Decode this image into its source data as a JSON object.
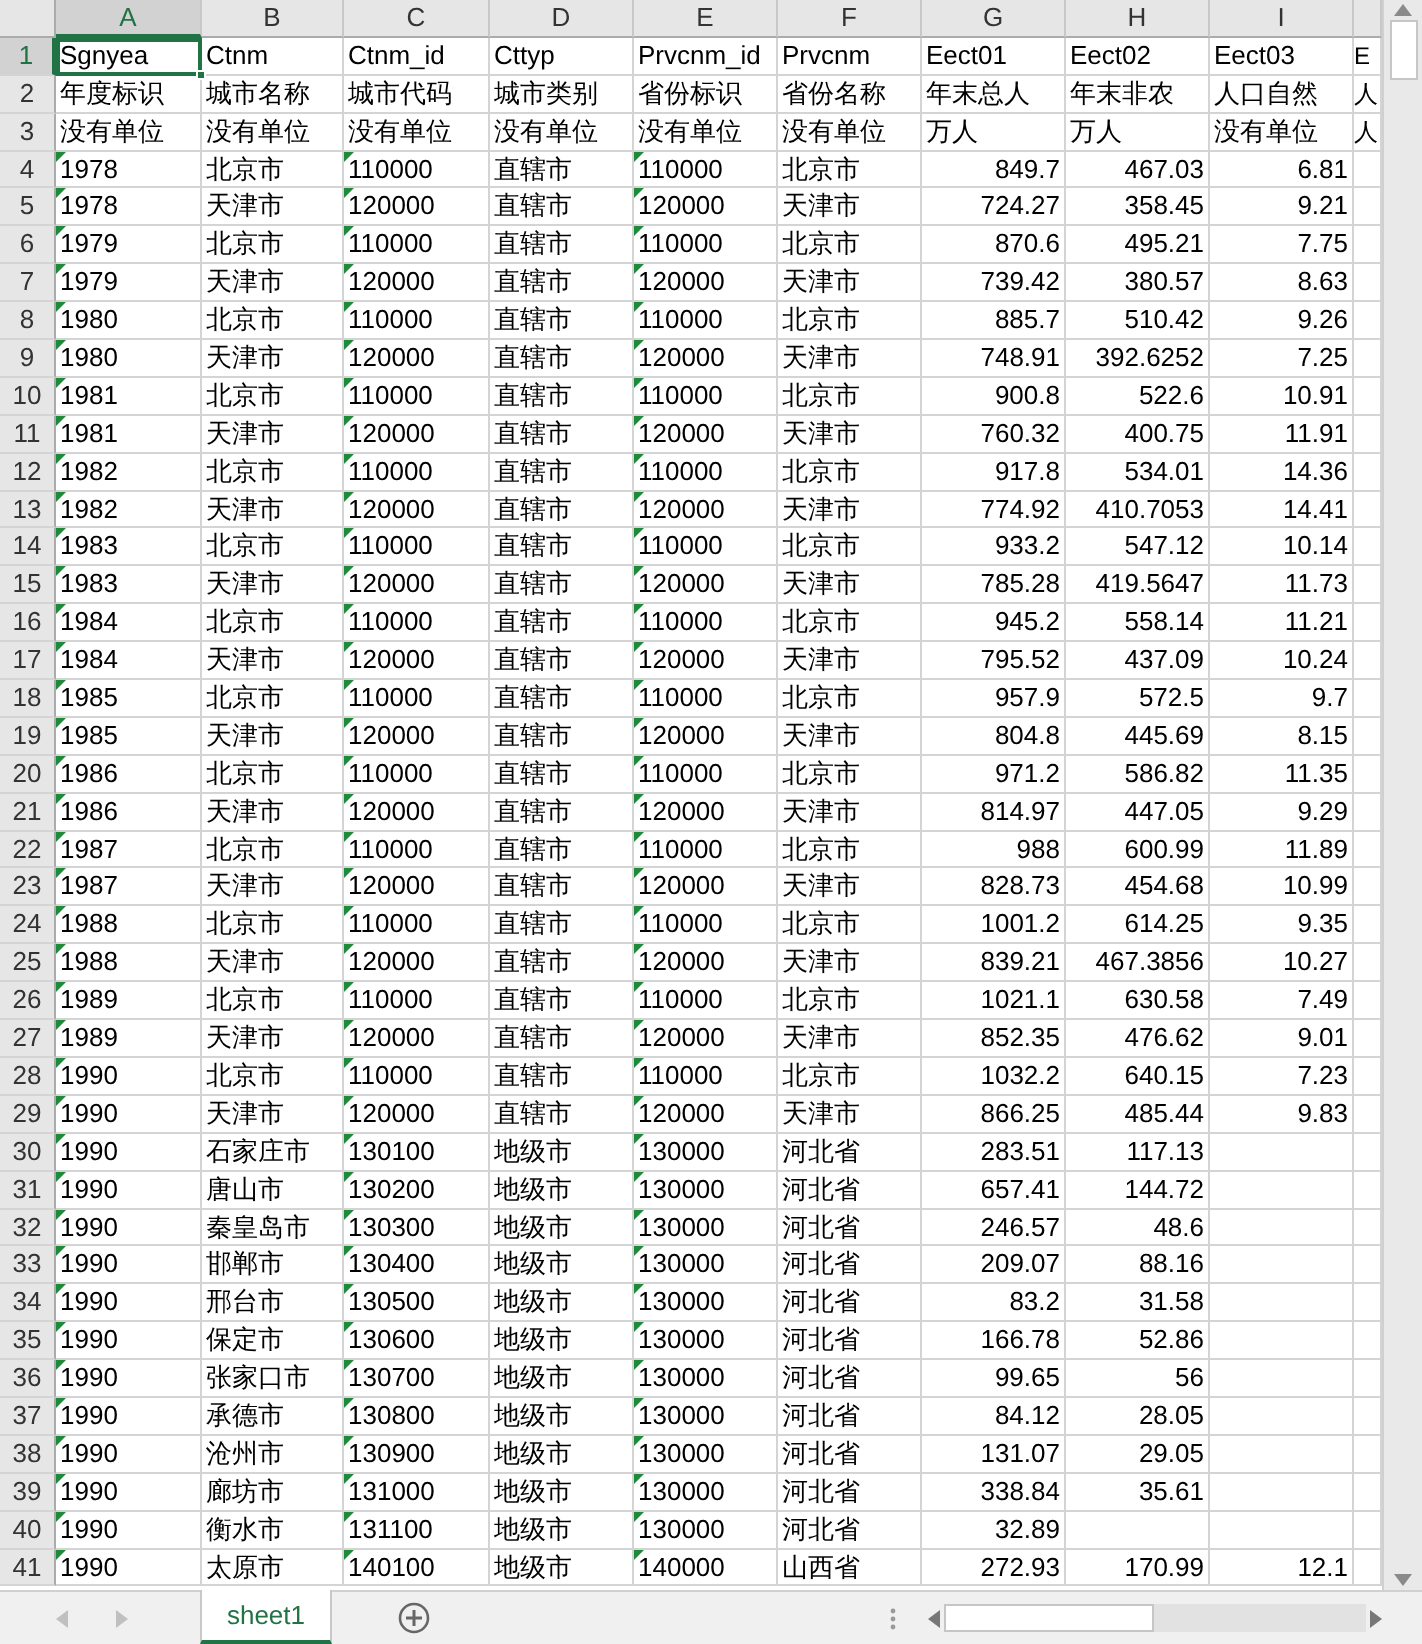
{
  "columns": [
    {
      "letter": "A",
      "selected": true,
      "error_flag": true,
      "numeric": false
    },
    {
      "letter": "B",
      "selected": false,
      "error_flag": false,
      "numeric": false
    },
    {
      "letter": "C",
      "selected": false,
      "error_flag": true,
      "numeric": false
    },
    {
      "letter": "D",
      "selected": false,
      "error_flag": false,
      "numeric": false
    },
    {
      "letter": "E",
      "selected": false,
      "error_flag": true,
      "numeric": false
    },
    {
      "letter": "F",
      "selected": false,
      "error_flag": false,
      "numeric": false
    },
    {
      "letter": "G",
      "selected": false,
      "error_flag": false,
      "numeric": true
    },
    {
      "letter": "H",
      "selected": false,
      "error_flag": false,
      "numeric": true
    },
    {
      "letter": "I",
      "selected": false,
      "error_flag": false,
      "numeric": true
    },
    {
      "selected": false,
      "error_flag": false,
      "numeric": false
    }
  ],
  "rows": [
    {
      "number": "1",
      "selected": true,
      "kind": "header",
      "cells": [
        "Sgnyea",
        "Ctnm",
        "Ctnm_id",
        "Cttyp",
        "Prvcnm_id",
        "Prvcnm",
        "Eect01",
        "Eect02",
        "Eect03",
        "E"
      ]
    },
    {
      "number": "2",
      "selected": false,
      "kind": "header",
      "cells": [
        "年度标识",
        "城市名称",
        "城市代码",
        "城市类别",
        "省份标识",
        "省份名称",
        "年末总人",
        "年末非农",
        "人口自然",
        "人"
      ]
    },
    {
      "number": "3",
      "selected": false,
      "kind": "header",
      "cells": [
        "没有单位",
        "没有单位",
        "没有单位",
        "没有单位",
        "没有单位",
        "没有单位",
        "万人",
        "万人",
        "没有单位",
        "人"
      ]
    },
    {
      "number": "4",
      "selected": false,
      "kind": "data",
      "cells": [
        "1978",
        "北京市",
        "110000",
        "直辖市",
        "110000",
        "北京市",
        "849.7",
        "467.03",
        "6.81"
      ]
    },
    {
      "number": "5",
      "selected": false,
      "kind": "data",
      "cells": [
        "1978",
        "天津市",
        "120000",
        "直辖市",
        "120000",
        "天津市",
        "724.27",
        "358.45",
        "9.21"
      ]
    },
    {
      "number": "6",
      "selected": false,
      "kind": "data",
      "cells": [
        "1979",
        "北京市",
        "110000",
        "直辖市",
        "110000",
        "北京市",
        "870.6",
        "495.21",
        "7.75"
      ]
    },
    {
      "number": "7",
      "selected": false,
      "kind": "data",
      "cells": [
        "1979",
        "天津市",
        "120000",
        "直辖市",
        "120000",
        "天津市",
        "739.42",
        "380.57",
        "8.63"
      ]
    },
    {
      "number": "8",
      "selected": false,
      "kind": "data",
      "cells": [
        "1980",
        "北京市",
        "110000",
        "直辖市",
        "110000",
        "北京市",
        "885.7",
        "510.42",
        "9.26"
      ]
    },
    {
      "number": "9",
      "selected": false,
      "kind": "data",
      "cells": [
        "1980",
        "天津市",
        "120000",
        "直辖市",
        "120000",
        "天津市",
        "748.91",
        "392.6252",
        "7.25"
      ]
    },
    {
      "number": "10",
      "selected": false,
      "kind": "data",
      "cells": [
        "1981",
        "北京市",
        "110000",
        "直辖市",
        "110000",
        "北京市",
        "900.8",
        "522.6",
        "10.91"
      ]
    },
    {
      "number": "11",
      "selected": false,
      "kind": "data",
      "cells": [
        "1981",
        "天津市",
        "120000",
        "直辖市",
        "120000",
        "天津市",
        "760.32",
        "400.75",
        "11.91"
      ]
    },
    {
      "number": "12",
      "selected": false,
      "kind": "data",
      "cells": [
        "1982",
        "北京市",
        "110000",
        "直辖市",
        "110000",
        "北京市",
        "917.8",
        "534.01",
        "14.36"
      ]
    },
    {
      "number": "13",
      "selected": false,
      "kind": "data",
      "cells": [
        "1982",
        "天津市",
        "120000",
        "直辖市",
        "120000",
        "天津市",
        "774.92",
        "410.7053",
        "14.41"
      ]
    },
    {
      "number": "14",
      "selected": false,
      "kind": "data",
      "cells": [
        "1983",
        "北京市",
        "110000",
        "直辖市",
        "110000",
        "北京市",
        "933.2",
        "547.12",
        "10.14"
      ]
    },
    {
      "number": "15",
      "selected": false,
      "kind": "data",
      "cells": [
        "1983",
        "天津市",
        "120000",
        "直辖市",
        "120000",
        "天津市",
        "785.28",
        "419.5647",
        "11.73"
      ]
    },
    {
      "number": "16",
      "selected": false,
      "kind": "data",
      "cells": [
        "1984",
        "北京市",
        "110000",
        "直辖市",
        "110000",
        "北京市",
        "945.2",
        "558.14",
        "11.21"
      ]
    },
    {
      "number": "17",
      "selected": false,
      "kind": "data",
      "cells": [
        "1984",
        "天津市",
        "120000",
        "直辖市",
        "120000",
        "天津市",
        "795.52",
        "437.09",
        "10.24"
      ]
    },
    {
      "number": "18",
      "selected": false,
      "kind": "data",
      "cells": [
        "1985",
        "北京市",
        "110000",
        "直辖市",
        "110000",
        "北京市",
        "957.9",
        "572.5",
        "9.7"
      ]
    },
    {
      "number": "19",
      "selected": false,
      "kind": "data",
      "cells": [
        "1985",
        "天津市",
        "120000",
        "直辖市",
        "120000",
        "天津市",
        "804.8",
        "445.69",
        "8.15"
      ]
    },
    {
      "number": "20",
      "selected": false,
      "kind": "data",
      "cells": [
        "1986",
        "北京市",
        "110000",
        "直辖市",
        "110000",
        "北京市",
        "971.2",
        "586.82",
        "11.35"
      ]
    },
    {
      "number": "21",
      "selected": false,
      "kind": "data",
      "cells": [
        "1986",
        "天津市",
        "120000",
        "直辖市",
        "120000",
        "天津市",
        "814.97",
        "447.05",
        "9.29"
      ]
    },
    {
      "number": "22",
      "selected": false,
      "kind": "data",
      "cells": [
        "1987",
        "北京市",
        "110000",
        "直辖市",
        "110000",
        "北京市",
        "988",
        "600.99",
        "11.89"
      ]
    },
    {
      "number": "23",
      "selected": false,
      "kind": "data",
      "cells": [
        "1987",
        "天津市",
        "120000",
        "直辖市",
        "120000",
        "天津市",
        "828.73",
        "454.68",
        "10.99"
      ]
    },
    {
      "number": "24",
      "selected": false,
      "kind": "data",
      "cells": [
        "1988",
        "北京市",
        "110000",
        "直辖市",
        "110000",
        "北京市",
        "1001.2",
        "614.25",
        "9.35"
      ]
    },
    {
      "number": "25",
      "selected": false,
      "kind": "data",
      "cells": [
        "1988",
        "天津市",
        "120000",
        "直辖市",
        "120000",
        "天津市",
        "839.21",
        "467.3856",
        "10.27"
      ]
    },
    {
      "number": "26",
      "selected": false,
      "kind": "data",
      "cells": [
        "1989",
        "北京市",
        "110000",
        "直辖市",
        "110000",
        "北京市",
        "1021.1",
        "630.58",
        "7.49"
      ]
    },
    {
      "number": "27",
      "selected": false,
      "kind": "data",
      "cells": [
        "1989",
        "天津市",
        "120000",
        "直辖市",
        "120000",
        "天津市",
        "852.35",
        "476.62",
        "9.01"
      ]
    },
    {
      "number": "28",
      "selected": false,
      "kind": "data",
      "cells": [
        "1990",
        "北京市",
        "110000",
        "直辖市",
        "110000",
        "北京市",
        "1032.2",
        "640.15",
        "7.23"
      ]
    },
    {
      "number": "29",
      "selected": false,
      "kind": "data",
      "cells": [
        "1990",
        "天津市",
        "120000",
        "直辖市",
        "120000",
        "天津市",
        "866.25",
        "485.44",
        "9.83"
      ]
    },
    {
      "number": "30",
      "selected": false,
      "kind": "data",
      "cells": [
        "1990",
        "石家庄市",
        "130100",
        "地级市",
        "130000",
        "河北省",
        "283.51",
        "117.13"
      ]
    },
    {
      "number": "31",
      "selected": false,
      "kind": "data",
      "cells": [
        "1990",
        "唐山市",
        "130200",
        "地级市",
        "130000",
        "河北省",
        "657.41",
        "144.72"
      ]
    },
    {
      "number": "32",
      "selected": false,
      "kind": "data",
      "cells": [
        "1990",
        "秦皇岛市",
        "130300",
        "地级市",
        "130000",
        "河北省",
        "246.57",
        "48.6"
      ]
    },
    {
      "number": "33",
      "selected": false,
      "kind": "data",
      "cells": [
        "1990",
        "邯郸市",
        "130400",
        "地级市",
        "130000",
        "河北省",
        "209.07",
        "88.16"
      ]
    },
    {
      "number": "34",
      "selected": false,
      "kind": "data",
      "cells": [
        "1990",
        "邢台市",
        "130500",
        "地级市",
        "130000",
        "河北省",
        "83.2",
        "31.58"
      ]
    },
    {
      "number": "35",
      "selected": false,
      "kind": "data",
      "cells": [
        "1990",
        "保定市",
        "130600",
        "地级市",
        "130000",
        "河北省",
        "166.78",
        "52.86"
      ]
    },
    {
      "number": "36",
      "selected": false,
      "kind": "data",
      "cells": [
        "1990",
        "张家口市",
        "130700",
        "地级市",
        "130000",
        "河北省",
        "99.65",
        "56"
      ]
    },
    {
      "number": "37",
      "selected": false,
      "kind": "data",
      "cells": [
        "1990",
        "承德市",
        "130800",
        "地级市",
        "130000",
        "河北省",
        "84.12",
        "28.05"
      ]
    },
    {
      "number": "38",
      "selected": false,
      "kind": "data",
      "cells": [
        "1990",
        "沧州市",
        "130900",
        "地级市",
        "130000",
        "河北省",
        "131.07",
        "29.05"
      ]
    },
    {
      "number": "39",
      "selected": false,
      "kind": "data",
      "cells": [
        "1990",
        "廊坊市",
        "131000",
        "地级市",
        "130000",
        "河北省",
        "338.84",
        "35.61"
      ]
    },
    {
      "number": "40",
      "selected": false,
      "kind": "data",
      "cells": [
        "1990",
        "衡水市",
        "131100",
        "地级市",
        "130000",
        "河北省",
        "32.89"
      ]
    },
    {
      "number": "41",
      "selected": false,
      "kind": "data",
      "cells": [
        "1990",
        "太原市",
        "140100",
        "地级市",
        "140000",
        "山西省",
        "272.93",
        "170.99",
        "12.1"
      ]
    }
  ],
  "sheet_tabs": [
    {
      "label": "sheet1",
      "selected": true
    }
  ]
}
